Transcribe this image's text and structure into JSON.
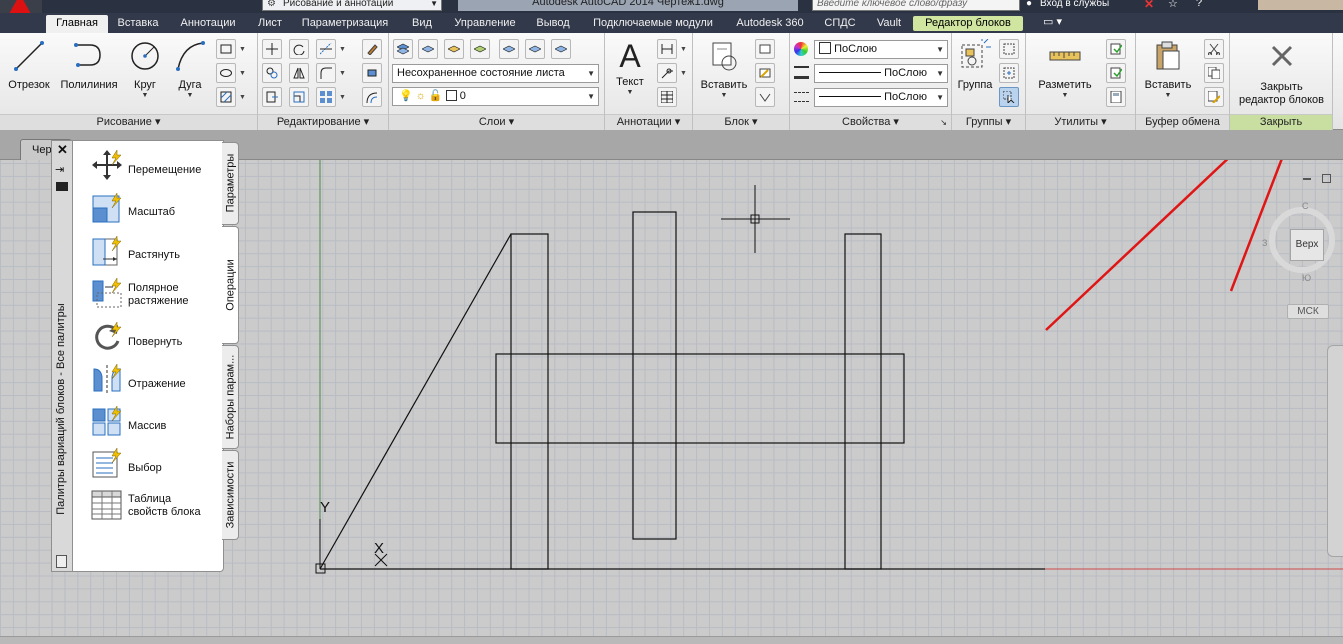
{
  "titlebar": {
    "workspace": "Рисование и аннотации",
    "title": "Autodesk AutoCAD 2014    Чертеж1.dwg",
    "search_placeholder": "Введите ключевое слово/фразу",
    "login": "Вход в службы"
  },
  "tabs": [
    "Главная",
    "Вставка",
    "Аннотации",
    "Лист",
    "Параметризация",
    "Вид",
    "Управление",
    "Вывод",
    "Подключаемые модули",
    "Autodesk 360",
    "СПДС",
    "Vault",
    "Редактор блоков"
  ],
  "ribbon": {
    "draw": {
      "title": "Рисование",
      "line": "Отрезок",
      "polyline": "Полилиния",
      "circle": "Круг",
      "arc": "Дуга"
    },
    "modify": {
      "title": "Редактирование"
    },
    "layers": {
      "title": "Слои",
      "layer_state": "Несохраненное состояние листа",
      "current_layer": "0"
    },
    "annotation": {
      "title": "Аннотации",
      "text": "Текст"
    },
    "block": {
      "title": "Блок",
      "insert": "Вставить"
    },
    "properties": {
      "title": "Свойства",
      "color": "ПоСлою",
      "linetype": "ПоСлою",
      "lineweight": "ПоСлою"
    },
    "groups": {
      "title": "Группы",
      "group": "Группа"
    },
    "utilities": {
      "title": "Утилиты",
      "measure": "Разметить"
    },
    "clipboard": {
      "title": "Буфер обмена",
      "paste": "Вставить"
    },
    "close": {
      "title": "Закрыть",
      "close_editor_line1": "Закрыть",
      "close_editor_line2": "редактор блоков"
    }
  },
  "document_tab": "Чер",
  "palette": {
    "title": "Палитры вариаций блоков - Все палитры",
    "items": [
      {
        "label": "Перемещение",
        "icon": "move-action-icon"
      },
      {
        "label": "Масштаб",
        "icon": "scale-action-icon"
      },
      {
        "label": "Растянуть",
        "icon": "stretch-action-icon"
      },
      {
        "label": "Полярное",
        "label2": "растяжение",
        "icon": "polar-stretch-action-icon"
      },
      {
        "label": "Повернуть",
        "icon": "rotate-action-icon"
      },
      {
        "label": "Отражение",
        "icon": "flip-action-icon"
      },
      {
        "label": "Массив",
        "icon": "array-action-icon"
      },
      {
        "label": "Выбор",
        "icon": "lookup-action-icon"
      },
      {
        "label": "Таблица",
        "label2": "свойств блока",
        "icon": "block-table-icon"
      }
    ],
    "side_tabs": [
      "Параметры",
      "Операции",
      "Наборы парам...",
      "Зависимости"
    ]
  },
  "ucs": {
    "y": "Y",
    "x": "X"
  },
  "viewcube": {
    "face": "Верх",
    "wcs": "МСК",
    "north": "С",
    "south": "Ю",
    "west": "З"
  },
  "colors": {
    "ribbon_tab_bar": "#32394a",
    "block_editor_tab": "#cfe5a0",
    "canvas": "#cbcbcb",
    "annotation_arrows": "#e01515"
  }
}
